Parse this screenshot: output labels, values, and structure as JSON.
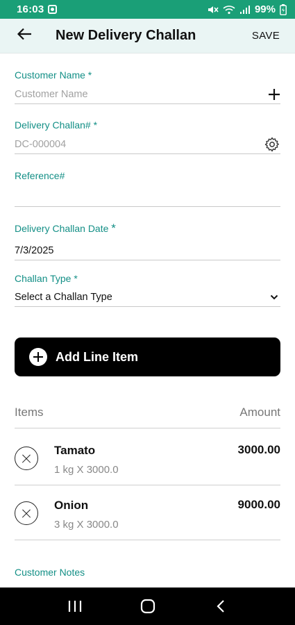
{
  "status_bar": {
    "time": "16:03",
    "battery_percent": "99%",
    "icons": [
      "app-notification-icon",
      "mute-icon",
      "wifi-icon",
      "signal-icon",
      "battery-charging-icon"
    ]
  },
  "app_bar": {
    "title": "New Delivery Challan",
    "save_label": "SAVE",
    "back_icon": "arrow-left-icon"
  },
  "form": {
    "customer_name": {
      "label": "Customer Name *",
      "placeholder": "Customer Name",
      "value": "",
      "icon": "plus-icon"
    },
    "challan_number": {
      "label": "Delivery Challan# *",
      "placeholder": "DC-000004",
      "value": "",
      "icon": "gear-icon"
    },
    "reference": {
      "label": "Reference#",
      "value": ""
    },
    "challan_date": {
      "label": "Delivery Challan Date",
      "required_mark": "*",
      "value": "7/3/2025"
    },
    "challan_type": {
      "label": "Challan Type *",
      "value": "Select a Challan Type",
      "icon": "chevron-down-icon"
    }
  },
  "add_line_item": {
    "label": "Add Line Item",
    "icon": "plus-circle-icon"
  },
  "items": {
    "header_items": "Items",
    "header_amount": "Amount",
    "rows": [
      {
        "name": "Tamato",
        "quantity_text": "1 kg X 3000.0",
        "amount": "3000.00"
      },
      {
        "name": "Onion",
        "quantity_text": "3 kg X 3000.0",
        "amount": "9000.00"
      }
    ]
  },
  "customer_notes": {
    "label": "Customer Notes"
  },
  "nav_bar": {
    "icons": [
      "recent-apps-icon",
      "home-icon",
      "back-icon"
    ]
  },
  "colors": {
    "primary": "#1a9f77",
    "label": "#138f86",
    "app_bar_bg": "#eaf5f4",
    "button_bg": "#000000"
  }
}
